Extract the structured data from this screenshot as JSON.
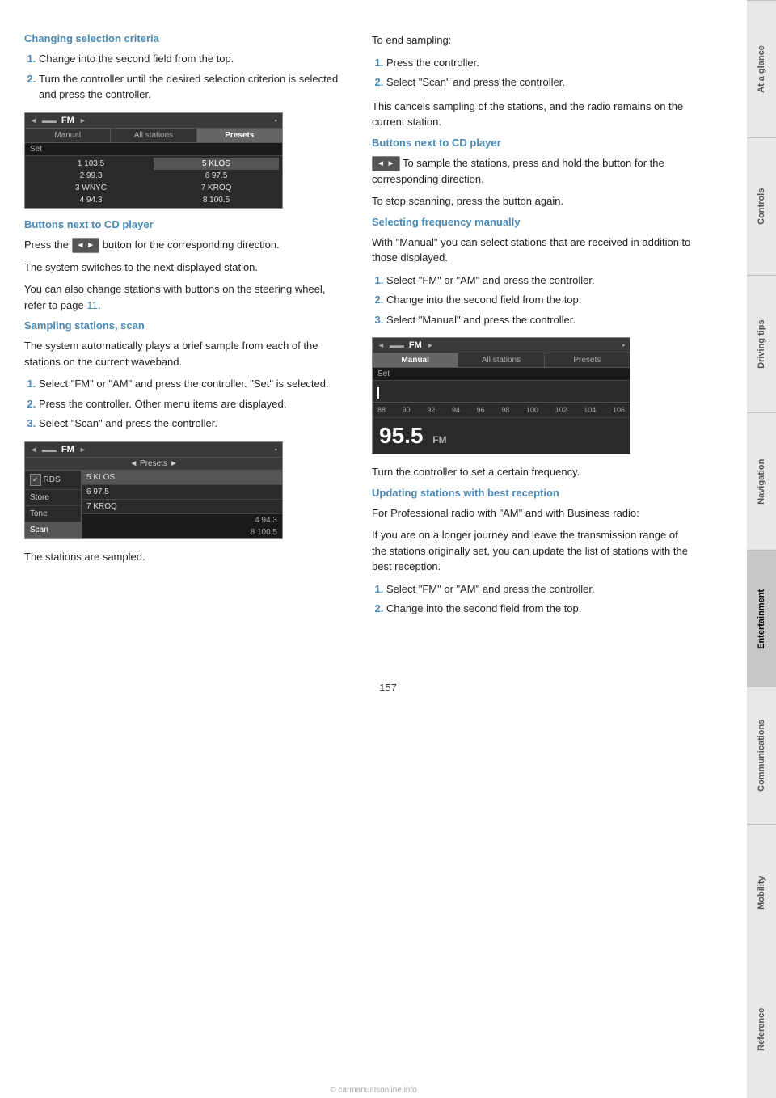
{
  "page": {
    "number": "157"
  },
  "side_tabs": [
    {
      "label": "At a glance",
      "active": false
    },
    {
      "label": "Controls",
      "active": false
    },
    {
      "label": "Driving tips",
      "active": false
    },
    {
      "label": "Navigation",
      "active": false
    },
    {
      "label": "Entertainment",
      "active": true
    },
    {
      "label": "Communications",
      "active": false
    },
    {
      "label": "Mobility",
      "active": false
    },
    {
      "label": "Reference",
      "active": false
    }
  ],
  "left_col": {
    "sections": [
      {
        "id": "changing-selection",
        "heading": "Changing selection criteria",
        "steps": [
          "Change into the second field from the top.",
          "Turn the controller until the desired selection criterion is selected and press the controller."
        ],
        "radio_screen_1": {
          "header": {
            "left_arrow": "◄",
            "label": "FM",
            "right_arrow": "►"
          },
          "tabs": [
            "Manual",
            "All stations",
            "Presets"
          ],
          "selected_tab": "Presets",
          "set_row": "Set",
          "stations": [
            {
              "col": 1,
              "num": "1",
              "freq": "103.5"
            },
            {
              "col": 2,
              "name": "5 KLOS"
            },
            {
              "col": 1,
              "num": "2",
              "freq": "99.3"
            },
            {
              "col": 2,
              "freq": "6 97.5"
            },
            {
              "col": 1,
              "name": "3 WNYC"
            },
            {
              "col": 2,
              "name": "7 KROQ"
            },
            {
              "col": 1,
              "num": "4",
              "freq": "94.3"
            },
            {
              "col": 2,
              "freq": "8 100.5"
            }
          ]
        }
      },
      {
        "id": "buttons-cd",
        "heading": "Buttons next to CD player",
        "body": [
          "Press the [◄►] button for the corresponding direction.",
          "The system switches to the next displayed station.",
          "You can also change stations with buttons on the steering wheel, refer to page 11."
        ]
      },
      {
        "id": "sampling-stations",
        "heading": "Sampling stations, scan",
        "intro": "The system automatically plays a brief sample from each of the stations on the current waveband.",
        "steps": [
          "Select \"FM\" or \"AM\" and press the controller. \"Set\" is selected.",
          "Press the controller. Other menu items are displayed.",
          "Select \"Scan\" and press the controller."
        ],
        "scan_screen": {
          "header": {
            "left_arrow": "◄",
            "label": "FM",
            "right_arrow": "►"
          },
          "presets_row": "◄ Presets ►",
          "menu_items": [
            {
              "label": "RDS",
              "icon": "checkbox",
              "active": false
            },
            {
              "label": "Store",
              "active": false
            },
            {
              "label": "Tone",
              "active": false
            },
            {
              "label": "Scan",
              "active": true
            }
          ],
          "stations": [
            {
              "name": "5 KLOS",
              "highlighted": true
            },
            {
              "name": "6 97.5",
              "highlighted": false
            },
            {
              "name": "7 KROQ",
              "highlighted": false
            }
          ],
          "bottom": "8 100.5",
          "bottom_num": "4 94.3"
        },
        "footer": "The stations are sampled."
      }
    ]
  },
  "right_col": {
    "sections": [
      {
        "id": "end-sampling",
        "heading": "To end sampling:",
        "steps": [
          "Press the controller.",
          "Select \"Scan\" and press the controller."
        ],
        "note": "This cancels sampling of the stations, and the radio remains on the current station."
      },
      {
        "id": "buttons-cd-right",
        "heading": "Buttons next to CD player",
        "body": [
          "To sample the stations, press and hold the button for the corresponding direction.",
          "To stop scanning, press the button again."
        ]
      },
      {
        "id": "selecting-frequency",
        "heading": "Selecting frequency manually",
        "intro": "With \"Manual\" you can select stations that are received in addition to those displayed.",
        "steps": [
          "Select \"FM\" or \"AM\" and press the controller.",
          "Change into the second field from the top.",
          "Select \"Manual\" and press the controller."
        ],
        "freq_screen": {
          "header": {
            "left_arrow": "◄",
            "label": "FM",
            "right_arrow": "►"
          },
          "tabs": [
            "Manual",
            "All stations",
            "Presets"
          ],
          "selected_tab": "Manual",
          "set_row": "Set",
          "scale": "88  90  92  94  96  98  100 102 104 106",
          "frequency": "95.5",
          "freq_unit": "FM"
        },
        "step4": "Turn the controller to set a certain frequency."
      },
      {
        "id": "updating-stations",
        "heading": "Updating stations with best reception",
        "intro": "For Professional radio with \"AM\" and with Business radio:",
        "body": "If you are on a longer journey and leave the transmission range of the stations originally set, you can update the list of stations with the best reception.",
        "steps": [
          "Select \"FM\" or \"AM\" and press the controller.",
          "Change into the second field from the top."
        ]
      }
    ]
  },
  "bottom_credit": "© carmanualsonline.info"
}
